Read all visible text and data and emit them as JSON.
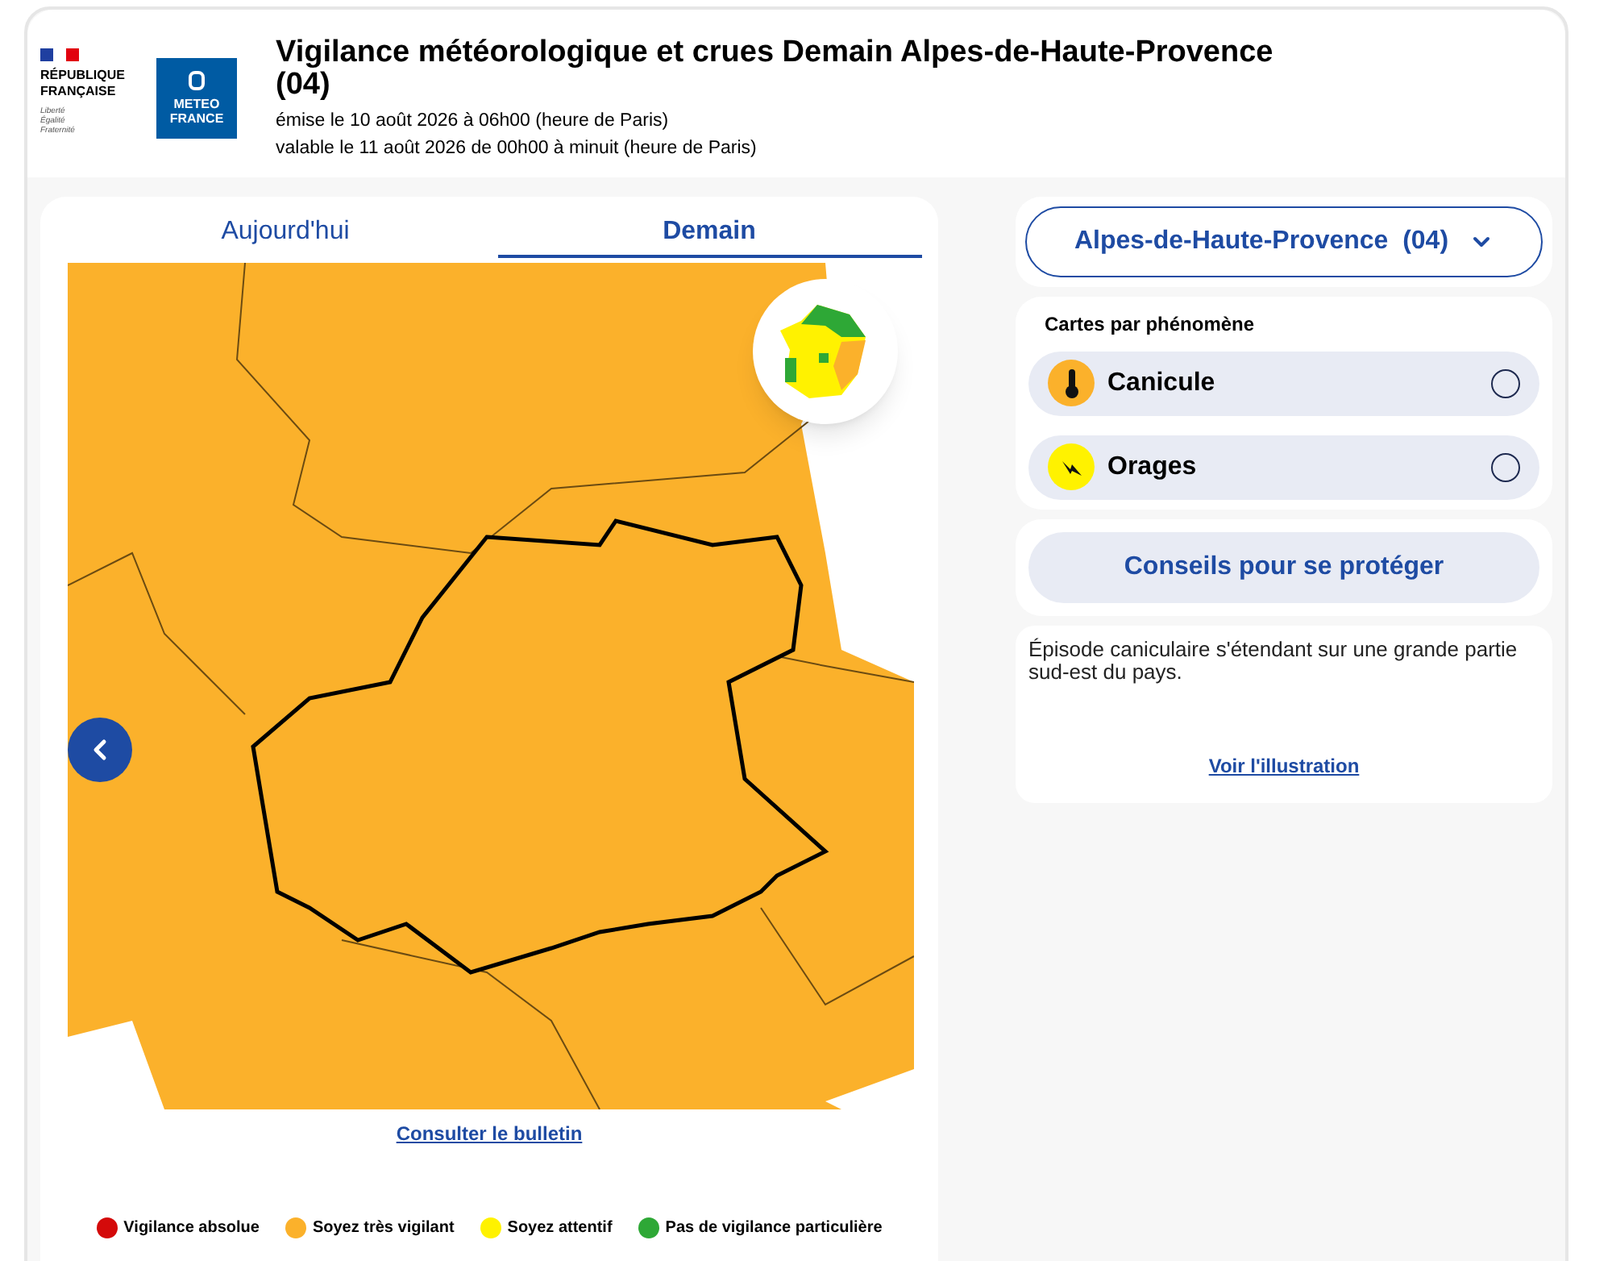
{
  "header": {
    "logo_rf": {
      "title": "RÉPUBLIQUE\nFRANÇAISE",
      "motto": "Liberté\nÉgalité\nFraternité"
    },
    "logo_mf": "METEO\nFRANCE",
    "title": "Vigilance météorologique et crues Demain Alpes-de-Haute-Provence (04)",
    "issued": "émise le 10 août 2026 à 06h00 (heure de Paris)",
    "valid": "valable le 11 août 2026 de 00h00 à minuit (heure de Paris)"
  },
  "tabs": [
    {
      "label": "Aujourd'hui",
      "selected": false
    },
    {
      "label": "Demain",
      "selected": true
    }
  ],
  "map": {
    "bulletin_link": "Consulter le bulletin"
  },
  "legend": [
    {
      "label": "Vigilance absolue",
      "color": "#d40a0a"
    },
    {
      "label": "Soyez très vigilant",
      "color": "#fbb12b"
    },
    {
      "label": "Soyez attentif",
      "color": "#fff200"
    },
    {
      "label": "Pas de vigilance particulière",
      "color": "#2ea836"
    }
  ],
  "department_select": "Alpes-de-Haute-Provence  (04)",
  "phenomena": {
    "title": "Cartes par phénomène",
    "items": [
      {
        "label": "Canicule",
        "kind": "thermometer",
        "color": "#fbb12b",
        "selected": false
      },
      {
        "label": "Orages",
        "kind": "lightning",
        "color": "#fff200",
        "selected": false
      }
    ]
  },
  "advice_button": "Conseils pour se protéger",
  "description": {
    "text": "Épisode caniculaire s'étendant sur une grande partie sud-est du pays.",
    "link": "Voir l'illustration"
  }
}
